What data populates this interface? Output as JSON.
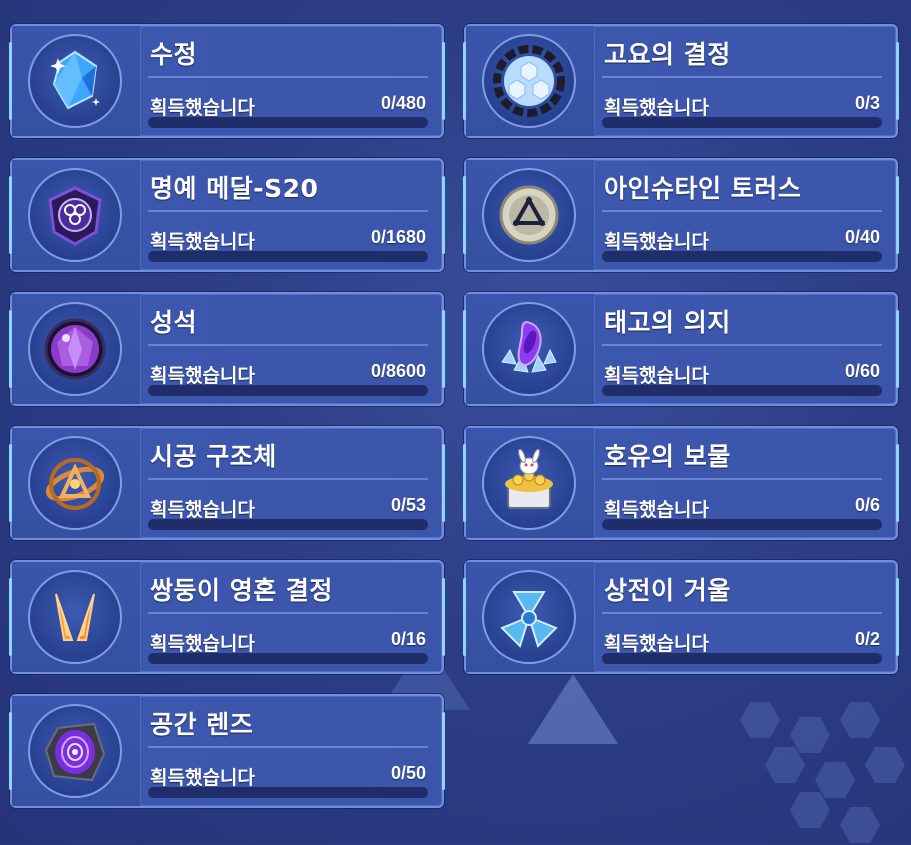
{
  "status_label": "획득했습니다",
  "items": [
    {
      "name": "수정",
      "count": "0/480",
      "progress": 0,
      "icon": "crystal-icon"
    },
    {
      "name": "고요의 결정",
      "count": "0/3",
      "progress": 0,
      "icon": "tranquil-crystal-icon"
    },
    {
      "name": "명예 메달-S20",
      "count": "0/1680",
      "progress": 0,
      "icon": "honor-medal-icon"
    },
    {
      "name": "아인슈타인 토러스",
      "count": "0/40",
      "progress": 0,
      "icon": "einstein-torus-icon"
    },
    {
      "name": "성석",
      "count": "0/8600",
      "progress": 0,
      "icon": "stigma-stone-icon"
    },
    {
      "name": "태고의 의지",
      "count": "0/60",
      "progress": 0,
      "icon": "primordial-will-icon"
    },
    {
      "name": "시공 구조체",
      "count": "0/53",
      "progress": 0,
      "icon": "spacetime-structure-icon"
    },
    {
      "name": "호유의 보물",
      "count": "0/6",
      "progress": 0,
      "icon": "treasure-icon"
    },
    {
      "name": "쌍둥이 영혼 결정",
      "count": "0/16",
      "progress": 0,
      "icon": "twin-soul-crystal-icon"
    },
    {
      "name": "상전이 거울",
      "count": "0/2",
      "progress": 0,
      "icon": "phase-mirror-icon"
    },
    {
      "name": "공간 렌즈",
      "count": "0/50",
      "progress": 0,
      "icon": "space-lens-icon"
    }
  ]
}
